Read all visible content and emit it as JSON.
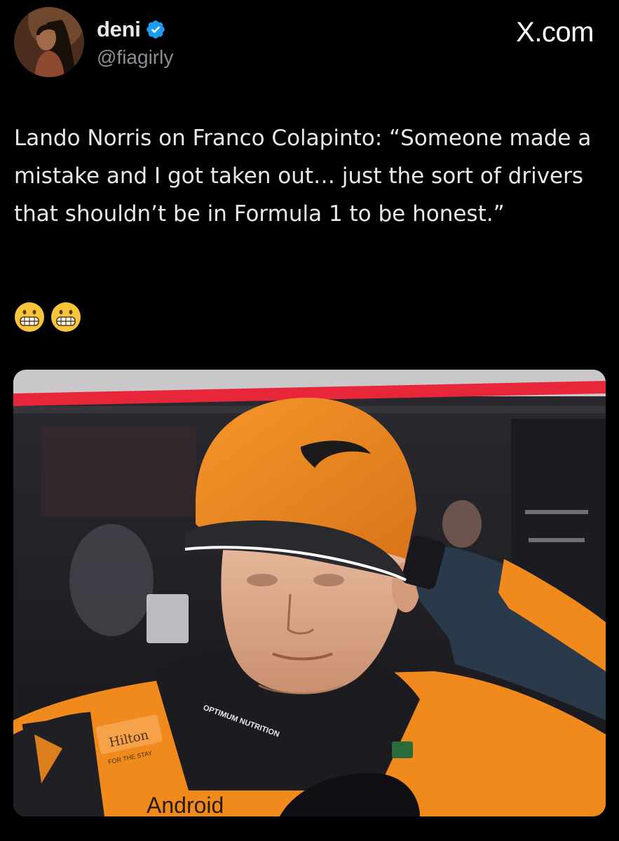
{
  "post": {
    "author": {
      "display_name": "deni",
      "handle": "@fiagirly",
      "verified": true,
      "avatar_icon": "profile-avatar"
    },
    "brand": "X.com",
    "text": "Lando Norris on Franco Colapinto: “Someone made a mistake and I got taken out… just the sort of drivers that shouldn’t be in Formula 1 to be honest.”",
    "emojis": [
      "grimacing-face",
      "grimacing-face"
    ],
    "media": {
      "type": "photo",
      "printed_text": {
        "sponsor_main": "Hilton",
        "sponsor_tagline": "FOR THE STAY",
        "collar_text": "OPTIMUM NUTRITION",
        "chest_text": "Android"
      }
    }
  },
  "colors": {
    "background": "#000000",
    "text_primary": "#e7e9ea",
    "text_secondary": "#8b8f94",
    "verified_blue": "#1d9bf0",
    "mclaren_papaya": "#f08a1c",
    "pit_red": "#e8263a"
  }
}
